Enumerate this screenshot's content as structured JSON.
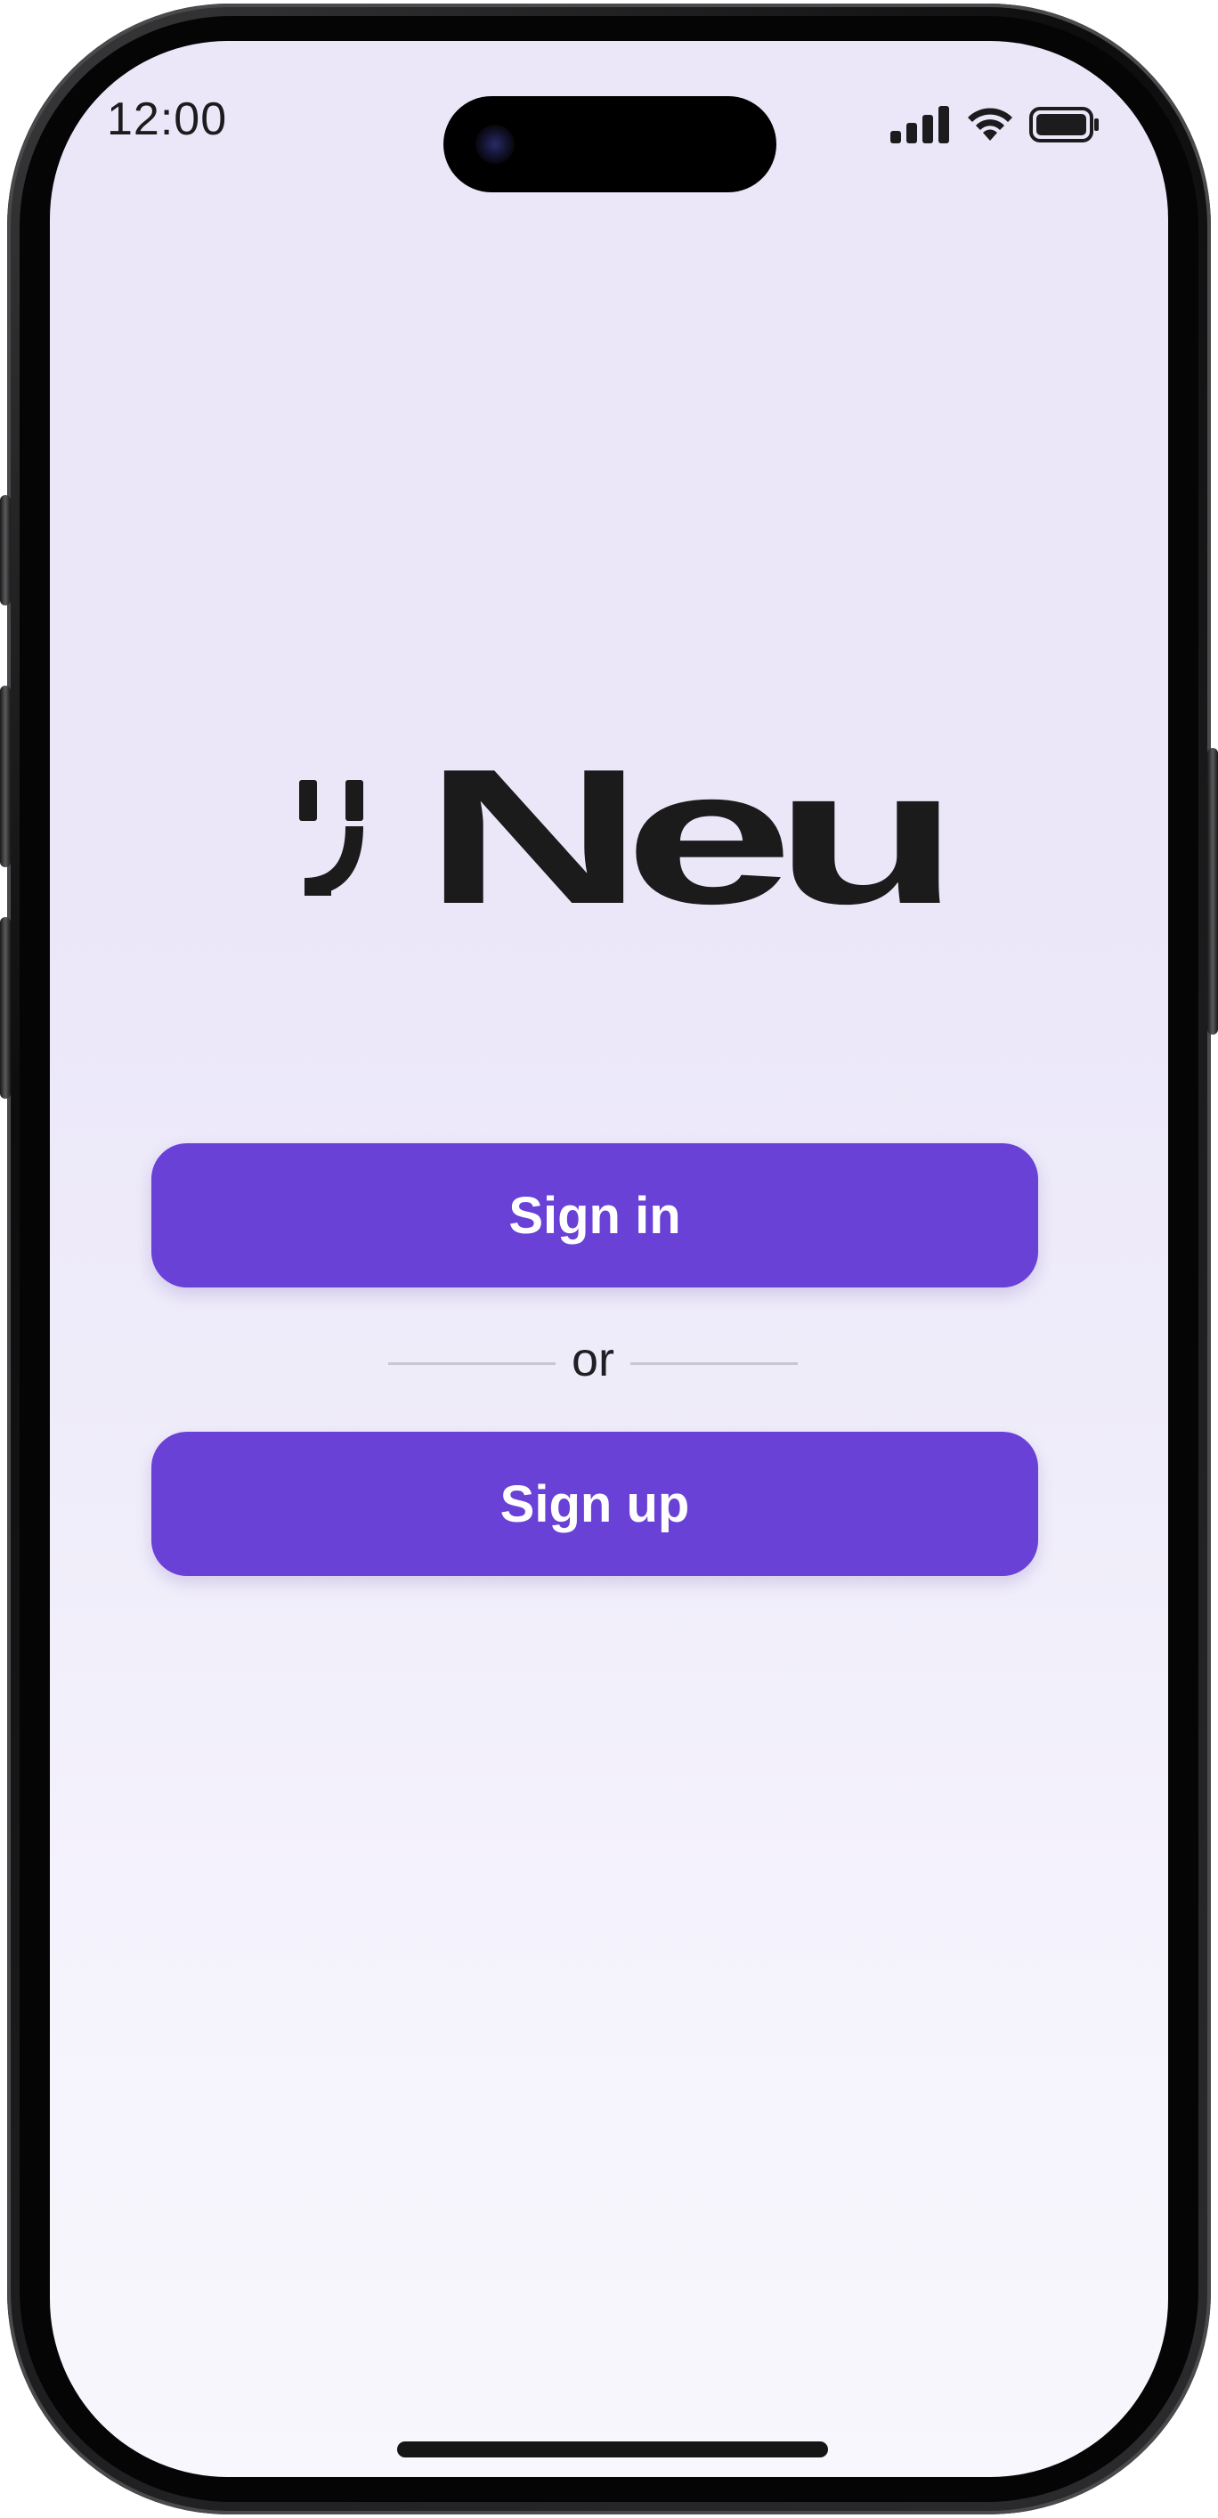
{
  "status_bar": {
    "time": "12:00",
    "icons": [
      "cellular-signal-icon",
      "wifi-icon",
      "battery-icon"
    ]
  },
  "logo": {
    "text": "Neu",
    "icon": "wink-smiley-icon"
  },
  "actions": {
    "sign_in_label": "Sign in",
    "divider_text": "or",
    "sign_up_label": "Sign up"
  },
  "colors": {
    "accent": "#6941d6",
    "background_top": "#ebe7f9",
    "background_bottom": "#f8f7fd",
    "logo": "#1b1b1b"
  }
}
